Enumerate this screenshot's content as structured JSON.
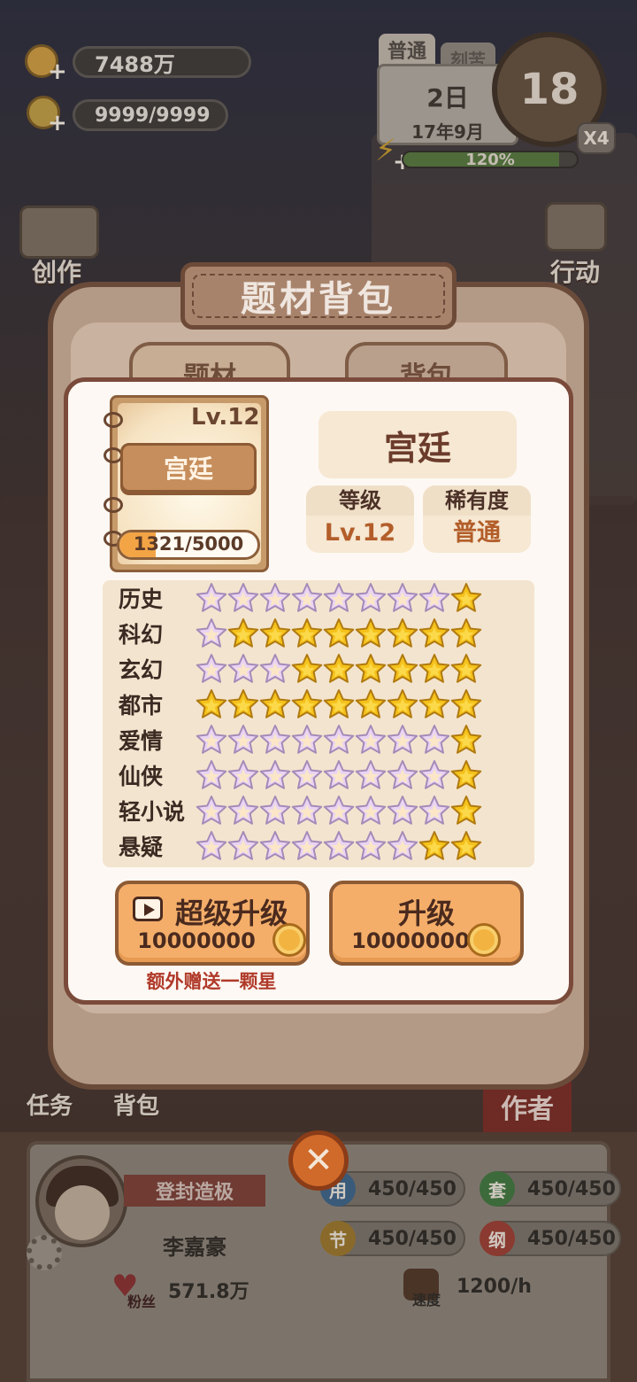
{
  "hud": {
    "coins": "7488万",
    "ideas": "9999/9999",
    "mode_tab_active": "普通",
    "mode_tab_inactive": "刻苦",
    "day": "2日",
    "month": "17年9月",
    "clock_value": "18",
    "speed_multiplier": "X4",
    "energy_percent": "120%",
    "energy_fill": 0.9
  },
  "side_menu": {
    "create": "创作",
    "action": "行动",
    "tasks": "任务",
    "bag": "背包",
    "author": "作者"
  },
  "modal": {
    "title": "题材背包",
    "tab_topics": "题材",
    "tab_bag": "背包",
    "topic_level_badge": "Lv.12",
    "topic_tag": "宫廷",
    "exp_text": "1321/5000",
    "exp_fraction": 0.2642,
    "topic_name": "宫廷",
    "level_label": "等级",
    "level_value": "Lv.12",
    "rarity_label": "稀有度",
    "rarity_value": "普通",
    "genres": [
      {
        "name": "历史",
        "gold_stars": 1
      },
      {
        "name": "科幻",
        "gold_stars": 8
      },
      {
        "name": "玄幻",
        "gold_stars": 6
      },
      {
        "name": "都市",
        "gold_stars": 9
      },
      {
        "name": "爱情",
        "gold_stars": 1
      },
      {
        "name": "仙侠",
        "gold_stars": 1
      },
      {
        "name": "轻小说",
        "gold_stars": 1
      },
      {
        "name": "悬疑",
        "gold_stars": 2
      }
    ],
    "max_stars": 9,
    "super_upgrade_label": "超级升级",
    "super_upgrade_cost": "10000000",
    "upgrade_label": "升级",
    "upgrade_cost": "10000000",
    "bonus_note": "额外赠送一颗星"
  },
  "author_panel": {
    "title_ribbon": "登封造极",
    "name": "李嘉豪",
    "fans_label": "粉丝",
    "fans_value": "571.8万",
    "stat_yong": {
      "icon": "用",
      "value": "450/450",
      "color": "#3a5a7a"
    },
    "stat_tao": {
      "icon": "套",
      "value": "450/450",
      "color": "#3d6a3a"
    },
    "stat_jie": {
      "icon": "节",
      "value": "450/450",
      "color": "#8a6a2a"
    },
    "stat_gang": {
      "icon": "纲",
      "value": "450/450",
      "color": "#8a3a30"
    },
    "speed_label": "速度",
    "speed_value": "1200/h"
  },
  "colors": {
    "gold_star": "#f5c21b",
    "rainbow_star": "#e9d4f3",
    "cost_text": "#4a2a1e",
    "rarity": "#b35e2a"
  }
}
